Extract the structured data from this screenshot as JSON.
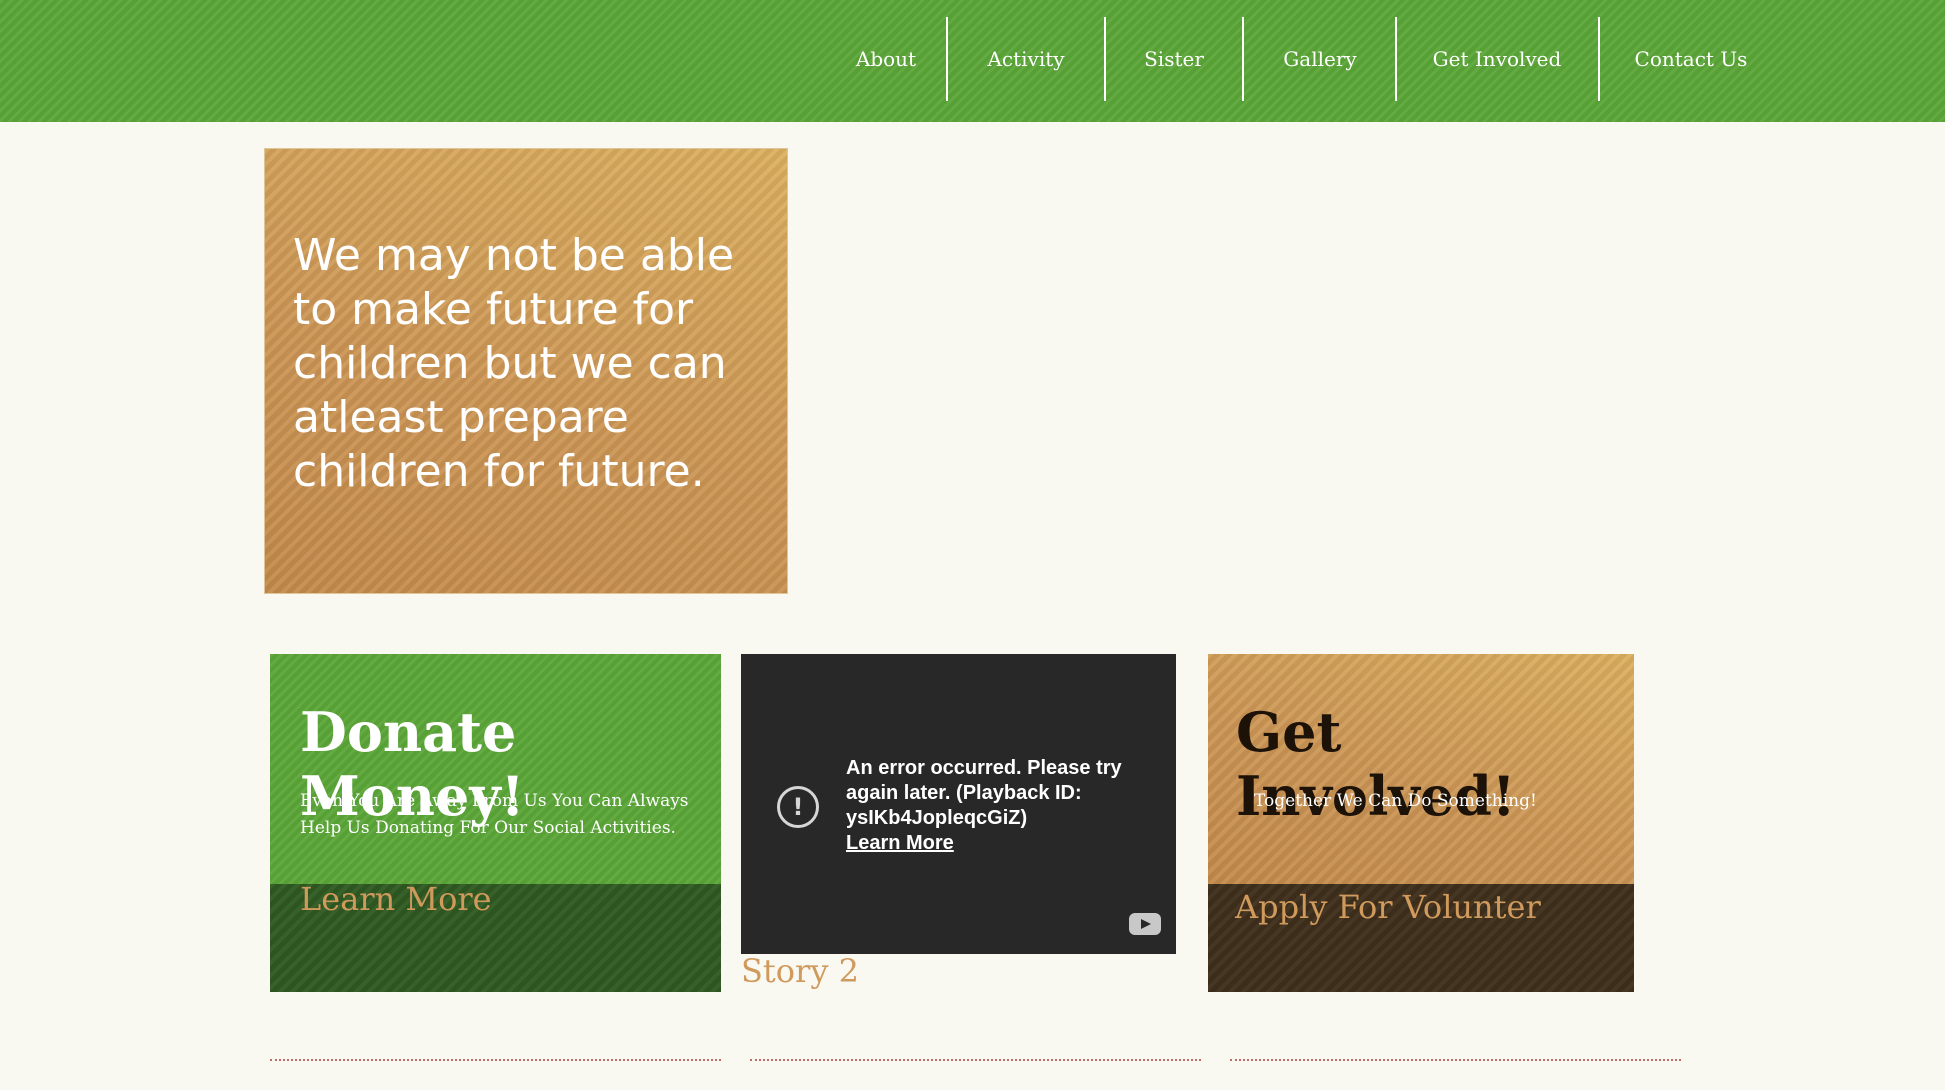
{
  "nav": {
    "items": [
      {
        "label": "About"
      },
      {
        "label": "Activity"
      },
      {
        "label": "Sister"
      },
      {
        "label": "Gallery"
      },
      {
        "label": "Get Involved"
      },
      {
        "label": "Contact Us"
      }
    ]
  },
  "hero": {
    "quote": "We may not be able to make future for children but we can atleast prepare children for future."
  },
  "donate": {
    "title": "Donate Money!",
    "description": "Even You Are Away From Us You Can Always Help Us Donating For Our Social Activities.",
    "link": "Learn More"
  },
  "video": {
    "error_message": "An error occurred. Please try again later. (Playback ID: ysIKb4JopleqcGiZ)",
    "learn_more": "Learn More",
    "alert_glyph": "!",
    "caption": "Story 2"
  },
  "involved": {
    "title": "Get Involved!",
    "description": "Together We Can Do Something!",
    "link": "Apply For Volunter"
  },
  "colors": {
    "header_green": "#5aa537",
    "card_gold": "#cc9655",
    "link_gold": "#d09a5c",
    "dark_green": "#2f5a22",
    "dark_brown": "#40301d",
    "page_bg": "#f9f8f1"
  },
  "icons": [
    "alert-circle-icon",
    "youtube-icon"
  ]
}
